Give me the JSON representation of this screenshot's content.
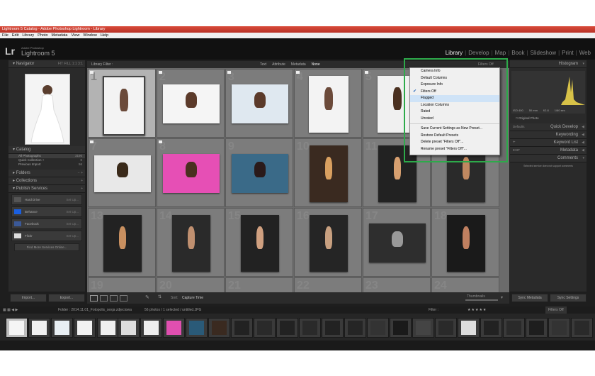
{
  "window": {
    "title": "Lightroom 5 Catalog - Adobe Photoshop Lightroom - Library"
  },
  "menu": [
    "File",
    "Edit",
    "Library",
    "Photo",
    "Metadata",
    "View",
    "Window",
    "Help"
  ],
  "identity": {
    "logo": "Lr",
    "product_small": "Adobe Photoshop",
    "product": "Lightroom 5"
  },
  "modules": [
    "Library",
    "Develop",
    "Map",
    "Book",
    "Slideshow",
    "Print",
    "Web"
  ],
  "left_panel": {
    "navigator": {
      "title": "Navigator",
      "zoom": "FIT  FILL  1:1  3:1"
    },
    "catalog": {
      "title": "Catalog",
      "items": [
        {
          "label": "All Photographs",
          "count": "3196"
        },
        {
          "label": "Quick Collection +",
          "count": "0"
        },
        {
          "label": "Previous Import",
          "count": "56"
        }
      ]
    },
    "folders": "Folders",
    "collections": "Collections",
    "publish": {
      "title": "Publish Services",
      "services": [
        {
          "label": "Hard Drive",
          "action": "Set Up..."
        },
        {
          "label": "Behance",
          "action": "Set Up..."
        },
        {
          "label": "Facebook",
          "action": "Set Up..."
        },
        {
          "label": "Flickr",
          "action": "Set Up..."
        }
      ],
      "find_more": "Find More Services Online..."
    },
    "import_label": "Import...",
    "export_label": "Export..."
  },
  "filter_bar": {
    "title": "Library Filter :",
    "options": [
      "Text",
      "Attribute",
      "Metadata",
      "None"
    ],
    "preset": "Filters Off"
  },
  "grid": {
    "cell_numbers": [
      "1",
      "2",
      "3",
      "4",
      "5",
      "6",
      "7",
      "8",
      "9",
      "10",
      "11",
      "12",
      "13",
      "14",
      "15",
      "16",
      "17",
      "18",
      "19",
      "20",
      "21",
      "22",
      "23",
      "24"
    ]
  },
  "toolbar": {
    "sort_label": "Sort:",
    "sort_value": "Capture Time",
    "thumbnails": "Thumbnails"
  },
  "right_panel": {
    "histogram": "Histogram",
    "exif": [
      "ISO 400",
      "50 mm",
      "f/2.8",
      "1/60 sec"
    ],
    "original_photo": "Original Photo",
    "quick_develop": {
      "title": "Quick Develop",
      "preset": "Defaults"
    },
    "keywording": "Keywording",
    "keyword_list": "Keyword List",
    "metadata": {
      "title": "Metadata",
      "preset": "EXIF"
    },
    "comments": {
      "title": "Comments",
      "note": "Selected service does not support comments"
    },
    "sync_metadata": "Sync Metadata",
    "sync_settings": "Sync Settings"
  },
  "dropdown": {
    "items": [
      {
        "label": "Camera Info",
        "checked": false,
        "highlight": false
      },
      {
        "label": "Default Columns",
        "checked": false,
        "highlight": false
      },
      {
        "label": "Exposure Info",
        "checked": false,
        "highlight": false
      },
      {
        "label": "Filters Off",
        "checked": true,
        "highlight": false
      },
      {
        "label": "Flagged",
        "checked": false,
        "highlight": true
      },
      {
        "label": "Location Columns",
        "checked": false,
        "highlight": false
      },
      {
        "label": "Rated",
        "checked": false,
        "highlight": false
      },
      {
        "label": "Unrated",
        "checked": false,
        "highlight": false
      },
      {
        "sep": true
      },
      {
        "label": "Save Current Settings as New Preset...",
        "checked": false,
        "highlight": false
      },
      {
        "label": "Restore Default Presets",
        "checked": false,
        "highlight": false
      },
      {
        "label": "Delete preset \"Filters Off\"...",
        "checked": false,
        "highlight": false
      },
      {
        "label": "Rename preset \"Filters Off\"...",
        "checked": false,
        "highlight": false
      }
    ],
    "highlight_color": "#2daa4a"
  },
  "filmstrip": {
    "path": "Folder : 2014.11.01_Fotopolis_sesja zdjeciowa",
    "count": "56 photos / 1 selected / untitled.JPG",
    "filter_label": "Filter :",
    "filter_value": "Filters Off"
  }
}
